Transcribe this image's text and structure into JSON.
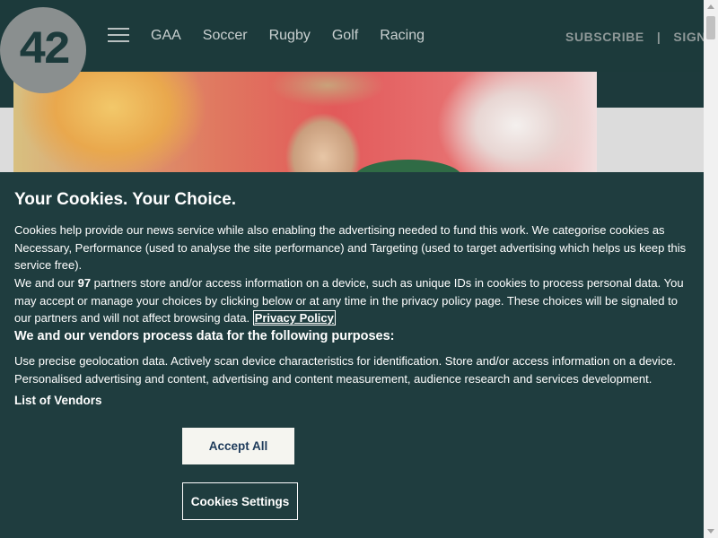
{
  "header": {
    "logo_text": "42",
    "nav": [
      "GAA",
      "Soccer",
      "Rugby",
      "Golf",
      "Racing"
    ],
    "subscribe_label": "SUBSCRIBE",
    "separator": "|",
    "sign_label": "SIGN"
  },
  "cookie_banner": {
    "title": "Your Cookies. Your Choice.",
    "paragraph1": "Cookies help provide our news service while also enabling the advertising needed to fund this work. We categorise cookies as Necessary, Performance (used to analyse the site performance) and Targeting (used to target advertising which helps us keep this service free).",
    "paragraph2_before": "We and our ",
    "partners_count": "97",
    "paragraph2_after": " partners store and/or access information on a device, such as unique IDs in cookies to process personal data. You may accept or manage your choices by clicking below or at any time in the privacy policy page. These choices will be signaled to our partners and will not affect browsing data.",
    "privacy_link": "Privacy Policy",
    "purposes_title": "We and our vendors process data for the following purposes:",
    "purposes_text": "Use precise geolocation data. Actively scan device characteristics for identification. Store and/or access information on a device. Personalised advertising and content, advertising and content measurement, audience research and services development.",
    "vendors_link": "List of Vendors",
    "accept_label": "Accept All",
    "settings_label": "Cookies Settings"
  },
  "colors": {
    "header_bg": "#1c3a3b",
    "banner_bg": "#1f3d3f",
    "accept_bg": "#f5f5f0",
    "accept_text": "#1d3a5a"
  }
}
